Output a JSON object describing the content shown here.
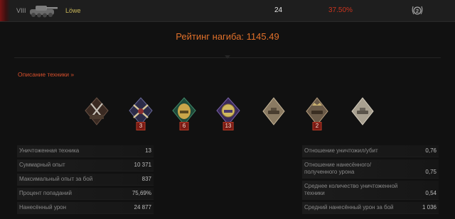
{
  "tank_row": {
    "tier": "VIII",
    "name": "Löwe",
    "battles": "24",
    "win_rate": "37.50%",
    "mastery_level": "2"
  },
  "rating": {
    "text": "Рейтинг нагиба: 1145.49"
  },
  "description_link": "Описание техники »",
  "medals": [
    {
      "icon": "crossed-swords-medal-icon",
      "count": ""
    },
    {
      "icon": "crossed-cannons-medal-icon",
      "count": "3"
    },
    {
      "icon": "green-tank-medal-icon",
      "count": "6"
    },
    {
      "icon": "purple-tank-medal-icon",
      "count": "13"
    },
    {
      "icon": "mastery-class-3-icon",
      "count": ""
    },
    {
      "icon": "mastery-class-2-icon",
      "count": "2"
    },
    {
      "icon": "mastery-class-1-icon",
      "count": ""
    }
  ],
  "stats_left": [
    {
      "label": "Уничтоженная техника",
      "value": "13"
    },
    {
      "label": "Суммарный опыт",
      "value": "10 371"
    },
    {
      "label": "Максимальный опыт за бой",
      "value": "837"
    },
    {
      "label": "Процент попаданий",
      "value": "75,69%"
    },
    {
      "label": "Нанесённый урон",
      "value": "24 877"
    }
  ],
  "stats_right": [
    {
      "label": "Отношение уничтожил/убит",
      "value": "0,76"
    },
    {
      "label": "Отношение нанесённого/полученного урона",
      "value": "0,75"
    },
    {
      "label": "Среднее количество уничтоженной техники",
      "value": "0,54"
    },
    {
      "label": "Средний нанесённый урон за бой",
      "value": "1 036"
    }
  ],
  "colors": {
    "accent_orange": "#e0702a",
    "win_rate_red": "#c8341e",
    "tank_name_gold": "#c9b75a"
  }
}
